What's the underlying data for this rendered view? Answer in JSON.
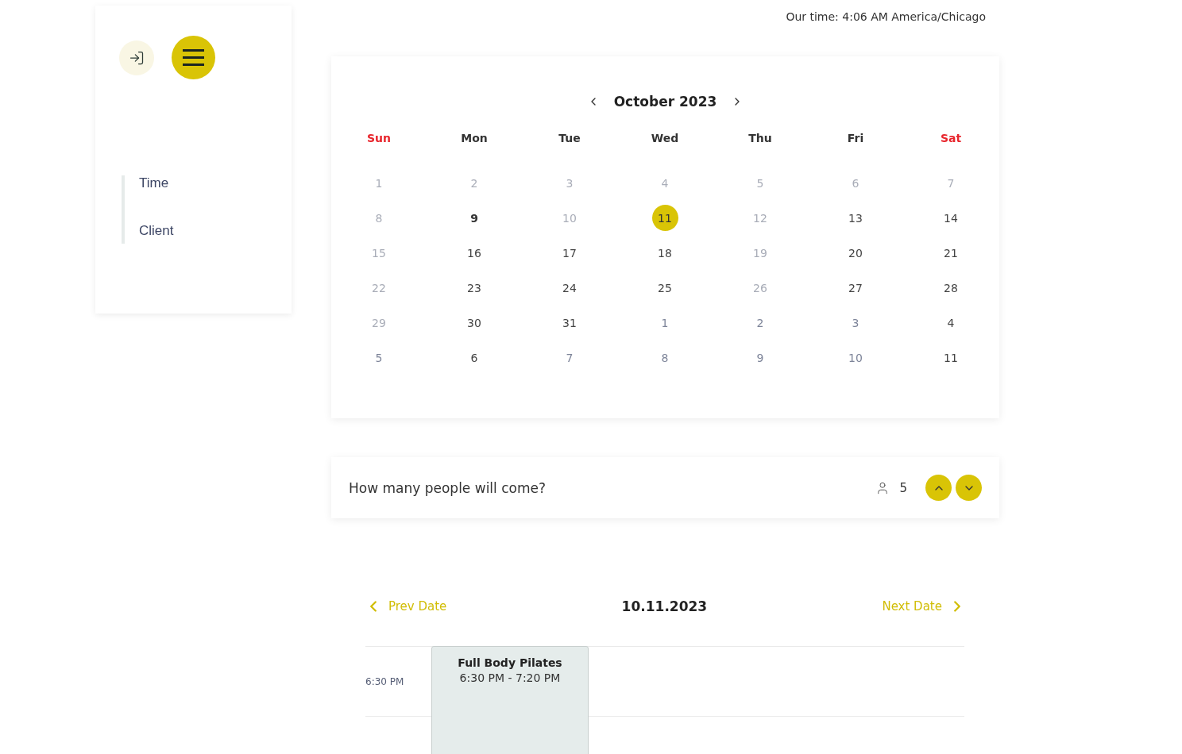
{
  "sidebar": {
    "nav_items": [
      {
        "label": "Time"
      },
      {
        "label": "Client"
      }
    ]
  },
  "clock": {
    "text": "Our time: 4:06 AM America/Chicago"
  },
  "calendar": {
    "month_label": "October 2023",
    "weekdays": [
      {
        "label": "Sun",
        "weekend": true
      },
      {
        "label": "Mon",
        "weekend": false
      },
      {
        "label": "Tue",
        "weekend": false
      },
      {
        "label": "Wed",
        "weekend": false
      },
      {
        "label": "Thu",
        "weekend": false
      },
      {
        "label": "Fri",
        "weekend": false
      },
      {
        "label": "Sat",
        "weekend": true
      }
    ],
    "days": [
      {
        "label": "1",
        "kind": "muted",
        "selected": false
      },
      {
        "label": "2",
        "kind": "muted",
        "selected": false
      },
      {
        "label": "3",
        "kind": "muted",
        "selected": false
      },
      {
        "label": "4",
        "kind": "muted",
        "selected": false
      },
      {
        "label": "5",
        "kind": "muted",
        "selected": false
      },
      {
        "label": "6",
        "kind": "muted",
        "selected": false
      },
      {
        "label": "7",
        "kind": "muted",
        "selected": false
      },
      {
        "label": "8",
        "kind": "muted",
        "selected": false
      },
      {
        "label": "9",
        "kind": "today",
        "selected": false
      },
      {
        "label": "10",
        "kind": "muted",
        "selected": false
      },
      {
        "label": "11",
        "kind": "normal",
        "selected": true
      },
      {
        "label": "12",
        "kind": "muted",
        "selected": false
      },
      {
        "label": "13",
        "kind": "normal",
        "selected": false
      },
      {
        "label": "14",
        "kind": "normal",
        "selected": false
      },
      {
        "label": "15",
        "kind": "muted",
        "selected": false
      },
      {
        "label": "16",
        "kind": "normal",
        "selected": false
      },
      {
        "label": "17",
        "kind": "normal",
        "selected": false
      },
      {
        "label": "18",
        "kind": "normal",
        "selected": false
      },
      {
        "label": "19",
        "kind": "muted",
        "selected": false
      },
      {
        "label": "20",
        "kind": "normal",
        "selected": false
      },
      {
        "label": "21",
        "kind": "normal",
        "selected": false
      },
      {
        "label": "22",
        "kind": "muted",
        "selected": false
      },
      {
        "label": "23",
        "kind": "normal",
        "selected": false
      },
      {
        "label": "24",
        "kind": "normal",
        "selected": false
      },
      {
        "label": "25",
        "kind": "normal",
        "selected": false
      },
      {
        "label": "26",
        "kind": "muted",
        "selected": false
      },
      {
        "label": "27",
        "kind": "normal",
        "selected": false
      },
      {
        "label": "28",
        "kind": "normal",
        "selected": false
      },
      {
        "label": "29",
        "kind": "muted",
        "selected": false
      },
      {
        "label": "30",
        "kind": "normal",
        "selected": false
      },
      {
        "label": "31",
        "kind": "normal",
        "selected": false
      },
      {
        "label": "1",
        "kind": "outside",
        "selected": false
      },
      {
        "label": "2",
        "kind": "outside",
        "selected": false
      },
      {
        "label": "3",
        "kind": "outside",
        "selected": false
      },
      {
        "label": "4",
        "kind": "normal",
        "selected": false
      },
      {
        "label": "5",
        "kind": "outside",
        "selected": false
      },
      {
        "label": "6",
        "kind": "normal",
        "selected": false
      },
      {
        "label": "7",
        "kind": "outside",
        "selected": false
      },
      {
        "label": "8",
        "kind": "outside",
        "selected": false
      },
      {
        "label": "9",
        "kind": "outside",
        "selected": false
      },
      {
        "label": "10",
        "kind": "outside",
        "selected": false
      },
      {
        "label": "11",
        "kind": "normal",
        "selected": false
      }
    ]
  },
  "people": {
    "question": "How many people will come?",
    "count": "5"
  },
  "day_nav": {
    "prev": "Prev Date",
    "date": "10.11.2023",
    "next": "Next Date"
  },
  "schedule": {
    "slots": [
      {
        "time": "6:30 PM",
        "events": [
          {
            "title": "Full Body Pilates",
            "time": "6:30 PM - 7:20 PM"
          }
        ]
      }
    ]
  }
}
